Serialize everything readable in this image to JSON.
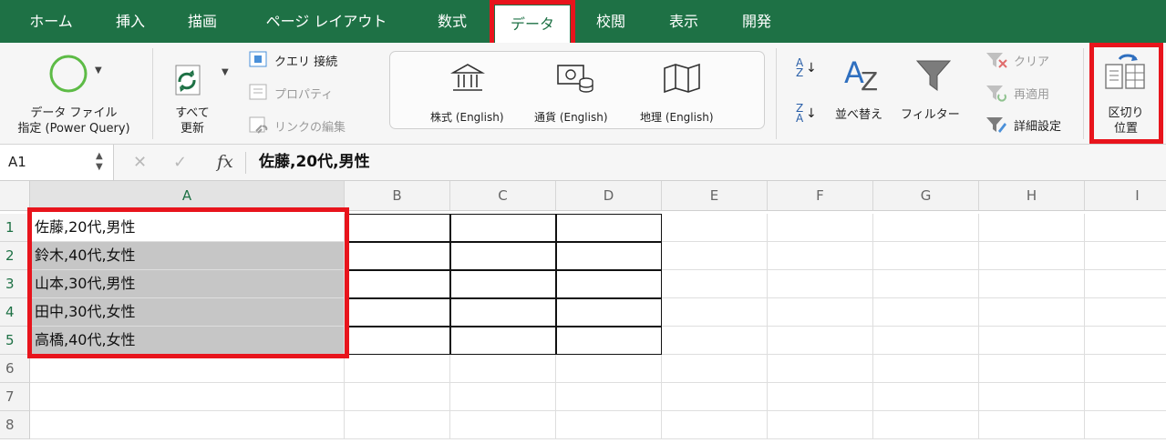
{
  "tabs": [
    "ホーム",
    "挿入",
    "描画",
    "ページ レイアウト",
    "数式",
    "データ",
    "校閲",
    "表示",
    "開発"
  ],
  "active_tab": "データ",
  "ribbon": {
    "get_data_label_1": "データ ファイル",
    "get_data_label_2": "指定 (Power Query)",
    "refresh_label_1": "すべて",
    "refresh_label_2": "更新",
    "queries_label": "クエリ 接続",
    "properties_label": "プロパティ",
    "edit_links_label": "リンクの編集",
    "stocks_label": "株式 (English)",
    "currency_label": "通貨 (English)",
    "geography_label": "地理 (English)",
    "sort_label": "並べ替え",
    "filter_label": "フィルター",
    "clear_label": "クリア",
    "reapply_label": "再適用",
    "advanced_label": "詳細設定",
    "text_to_columns_label_1": "区切り",
    "text_to_columns_label_2": "位置"
  },
  "formula_bar": {
    "name_box": "A1",
    "content": "佐藤,20代,男性",
    "fx": "fx",
    "cancel_symbol": "✕",
    "enter_symbol": "✓"
  },
  "columns": [
    "A",
    "B",
    "C",
    "D",
    "E",
    "F",
    "G",
    "H",
    "I"
  ],
  "rows": [
    "1",
    "2",
    "3",
    "4",
    "5",
    "6",
    "7",
    "8"
  ],
  "cells": {
    "A1": "佐藤,20代,男性",
    "A2": "鈴木,40代,女性",
    "A3": "山本,30代,男性",
    "A4": "田中,30代,女性",
    "A5": "高橋,40代,女性"
  },
  "colors": {
    "ribbon_green": "#1e7145",
    "highlight_red": "#e8141c",
    "selection_gray": "#c6c6c6"
  }
}
